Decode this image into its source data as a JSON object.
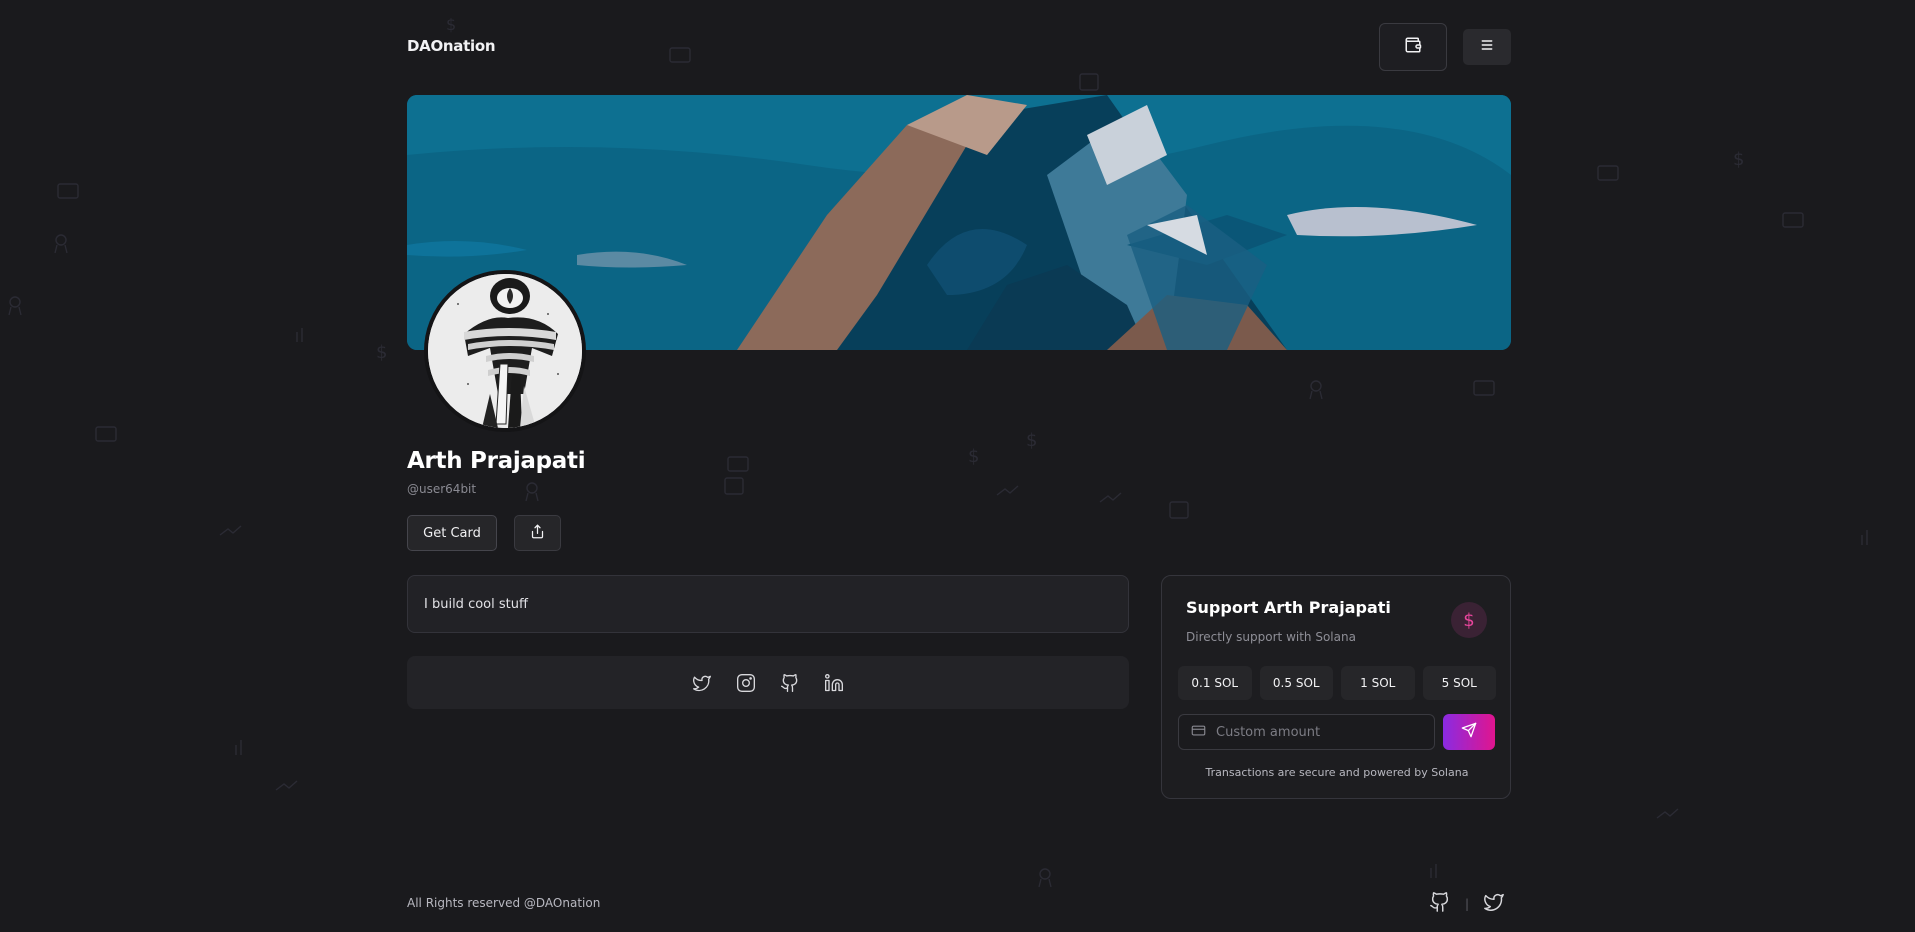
{
  "header": {
    "logo": "DAOnation",
    "wallet_icon": "wallet-icon",
    "menu_icon": "menu-icon"
  },
  "profile": {
    "name": "Arth Prajapati",
    "handle": "@user64bit",
    "get_card_label": "Get Card",
    "share_icon": "share-icon",
    "bio": "I build cool stuff"
  },
  "socials": [
    "twitter-icon",
    "instagram-icon",
    "github-icon",
    "linkedin-icon"
  ],
  "support": {
    "title": "Support Arth Prajapati",
    "subtitle": "Directly support with Solana",
    "amounts": [
      "0.1 SOL",
      "0.5 SOL",
      "1 SOL",
      "5 SOL"
    ],
    "custom_placeholder": "Custom amount",
    "secure_text": "Transactions are secure and powered by Solana",
    "accent_from": "#8a2be2",
    "accent_to": "#e0158e"
  },
  "footer": {
    "text": "All Rights reserved @DAOnation",
    "separator": "|"
  }
}
